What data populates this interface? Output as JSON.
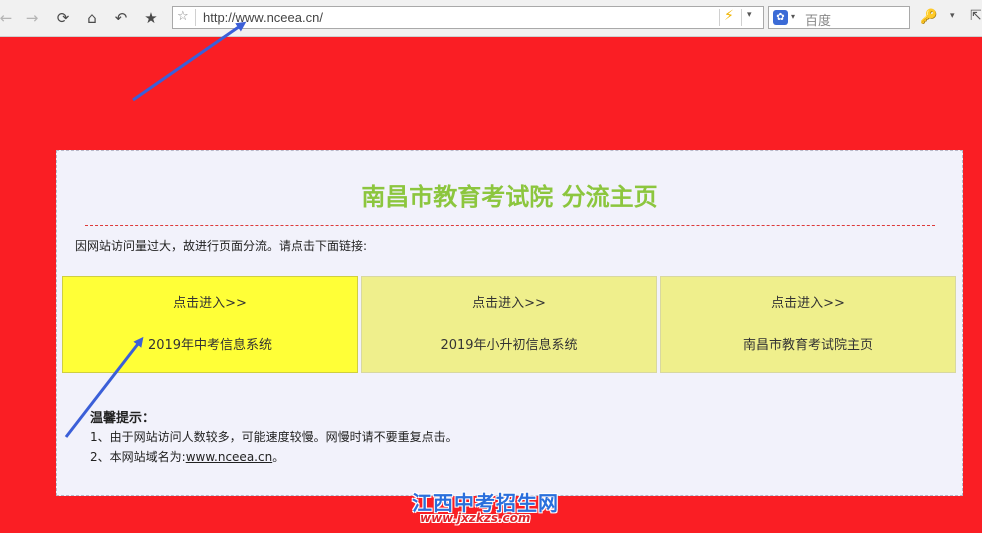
{
  "browser": {
    "back_icon": "←",
    "forward_icon": "→",
    "reload_icon": "⟳",
    "home_icon": "⌂",
    "undo_icon": "↶",
    "favorite_icon": "★",
    "bookmark_icon": "☆",
    "url": "http://www.nceea.cn/",
    "bolt_icon": "⚡",
    "dropdown_icon": "▾",
    "search_engine_icon": "✿",
    "search_placeholder": "百度",
    "key_icon": "🔑",
    "menu_icon": "▾",
    "extra_icon": "⇱"
  },
  "page": {
    "title": "南昌市教育考试院 分流主页",
    "notice": "因网站访问量过大，故进行页面分流。请点击下面链接:",
    "links": [
      {
        "enter": "点击进入>>",
        "name": "2019年中考信息系统"
      },
      {
        "enter": "点击进入>>",
        "name": "2019年小升初信息系统"
      },
      {
        "enter": "点击进入>>",
        "name": "南昌市教育考试院主页"
      }
    ],
    "tips_title": "温馨提示：",
    "tip1": "1、由于网站访问人数较多，可能速度较慢。网慢时请不要重复点击。",
    "tip2_prefix": "2、本网站域名为:",
    "tip2_link": "www.nceea.cn",
    "tip2_suffix": "。"
  },
  "watermark": {
    "name": "江西中考招生网",
    "url": "www.jxzkzs.com"
  },
  "colors": {
    "background": "#fa1e24",
    "title": "#8cc63e",
    "box_active": "#ffff37",
    "box": "#efef8c",
    "arrow": "#3b5fd8"
  }
}
